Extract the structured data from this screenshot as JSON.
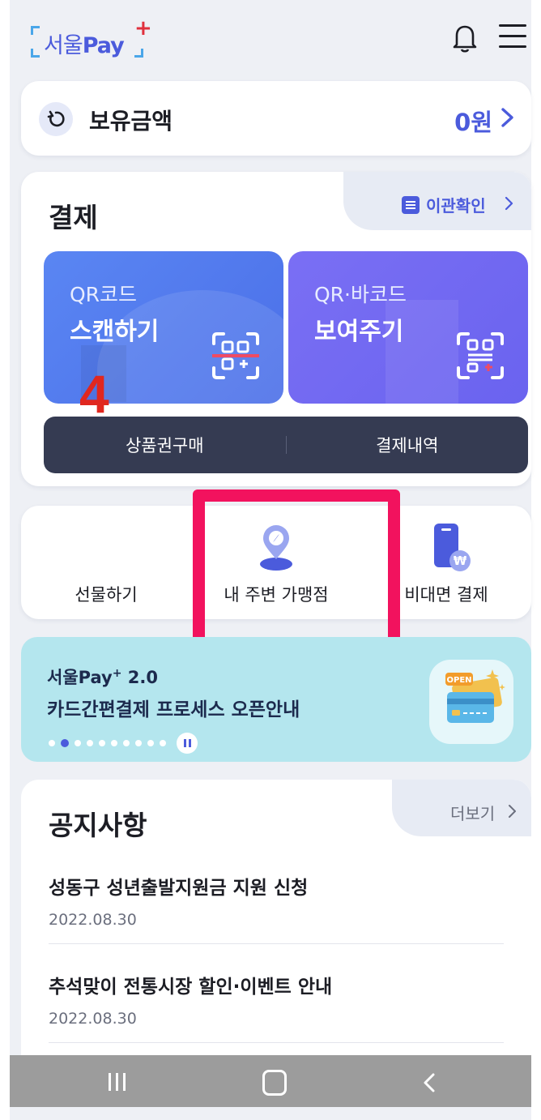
{
  "header": {
    "logo_korean": "서울",
    "logo_pay": "Pay",
    "logo_plus": "+",
    "bell_icon": "bell-icon",
    "menu_icon": "hamburger-menu-icon"
  },
  "balance": {
    "label": "보유금액",
    "amount": "0원"
  },
  "payment": {
    "title": "결제",
    "history_link": "이관확인",
    "scan_tile": {
      "sub": "QR코드",
      "main": "스캔하기"
    },
    "show_tile": {
      "sub": "QR·바코드",
      "main": "보여주기"
    },
    "step_number": "4",
    "buy_voucher": "상품권구매",
    "payment_history": "결제내역"
  },
  "quick_menu": {
    "gift": "선물하기",
    "nearby_stores": "내 주변 가맹점",
    "contactless_payment": "비대면 결제"
  },
  "banner": {
    "brand": "서울Pay",
    "brand_sup": "+",
    "version": " 2.0",
    "headline": "카드간편결제 프로세스 오픈안내",
    "badge_text": "OPEN",
    "page_total": 10,
    "page_active": 2
  },
  "notices": {
    "title": "공지사항",
    "more": "더보기",
    "items": [
      {
        "title": "성동구 성년출발지원금 지원 신청",
        "date": "2022.08.30"
      },
      {
        "title": "추석맞이 전통시장 할인·이벤트 안내",
        "date": "2022.08.30"
      }
    ]
  },
  "colors": {
    "brand_blue": "#4b5bdc",
    "highlight": "#f2125e",
    "step_red": "#e0271f",
    "dark_bar": "#353b52",
    "banner_bg": "#b4e6ee"
  }
}
